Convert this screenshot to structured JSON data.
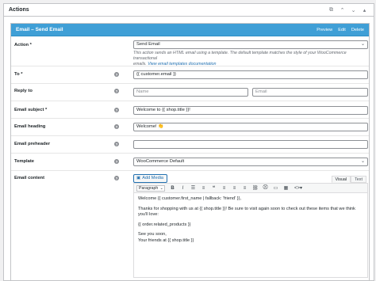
{
  "panel": {
    "title": "Actions",
    "controls": [
      "external-link-icon",
      "chevron-up-icon",
      "chevron-down-icon",
      "triangle-up-icon"
    ]
  },
  "action_box": {
    "title": "Email – Send Email",
    "links": {
      "preview": "Preview",
      "edit": "Edit",
      "delete": "Delete"
    }
  },
  "fields": {
    "action": {
      "label": "Action *",
      "value": "Send Email",
      "desc_1": "This action sends an HTML email using a template. The default template matches the style of your WooCommerce transactional",
      "desc_2": "emails. ",
      "desc_link": "View email templates documentation"
    },
    "to": {
      "label": "To *",
      "value": "{{ customer.email }}"
    },
    "reply_to": {
      "label": "Reply to",
      "name_placeholder": "Name",
      "email_placeholder": "Email"
    },
    "subject": {
      "label": "Email subject *",
      "value": "Welcome to {{ shop.title }}!"
    },
    "heading": {
      "label": "Email heading",
      "value": "Welcome! 👏"
    },
    "preheader": {
      "label": "Email preheader",
      "value": ""
    },
    "template": {
      "label": "Template",
      "value": "WooCommerce Default"
    },
    "content": {
      "label": "Email content",
      "add_media": "Add Media",
      "tab_visual": "Visual",
      "tab_text": "Text",
      "format": "Paragraph",
      "body": [
        "Welcome {{ customer.first_name | fallback: 'friend' }},",
        "Thanks for shopping with us at {{ shop.title }}! Be sure to visit again soon to check out these items that we think you'll love:",
        "{{ order.related_products }}",
        "See you soon,",
        "Your friends at {{ shop.title }}"
      ]
    }
  },
  "colors": {
    "header_blue": "#3f9fd6",
    "link_blue": "#2271b1",
    "border": "#c3c4c7"
  }
}
